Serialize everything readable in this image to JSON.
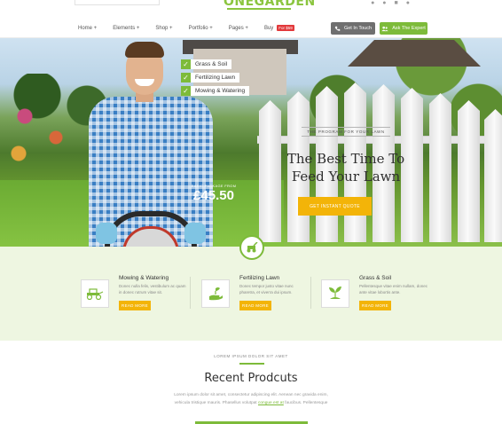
{
  "header": {
    "logo_text": "ONEGARDEN",
    "social_icons": [
      "twitter-icon",
      "facebook-icon",
      "instagram-icon",
      "googleplus-icon"
    ]
  },
  "nav": {
    "items": [
      "Home +",
      "Elements +",
      "Shop +",
      "Portfolio +",
      "Pages +",
      "Buy"
    ],
    "buy_badge": "For $59",
    "get_in_touch": "Get In Touch",
    "ask_expert": "Ask The Expert"
  },
  "hero": {
    "checklist": [
      "Grass & Soil",
      "Fertilizing Lawn",
      "Mowing & Watering"
    ],
    "price_label": "BASIC PACKAGE FROM",
    "price_value": "£45.50",
    "kicker": "THE PROGRAM FOR YOUR LAWN",
    "title_line1": "The Best Time To",
    "title_line2": "Feed Your Lawn",
    "cta": "GET INSTANT QUOTE"
  },
  "services": [
    {
      "title": "Mowing & Watering",
      "desc": "Donec nulla felis, vestibulum ac quam in donec rutrum vitae sit.",
      "button": "READ MORE",
      "icon": "tractor-icon"
    },
    {
      "title": "Fertilizing Lawn",
      "desc": "Donec tempor justo vitae nunc pharetra, et viverra dui ipsum.",
      "button": "READ MORE",
      "icon": "hand-plant-icon"
    },
    {
      "title": "Grass & Soil",
      "desc": "Pellentesque vitae enim nullam, donec ante vitae lobortis ante.",
      "button": "READ MORE",
      "icon": "sprout-icon"
    }
  ],
  "recent": {
    "kicker": "LOREM IPSUM DOLOR SIT AMET",
    "title": "Recent Prodcuts",
    "desc_line1": "Lorem ipsum dolor sit amet, consectetur adipiscing elit. Aenean nec gravida enim,",
    "desc_line2_pre": "vehicula tristique mauris. Phasellus volutpat",
    "desc_link": "congue est at",
    "desc_line2_post": "faucibus. Pellentesque"
  },
  "colors": {
    "accent_green": "#7dbb3a",
    "accent_yellow": "#f3b408",
    "nav_gray": "#6f6f6f",
    "badge_red": "#e2393b"
  }
}
